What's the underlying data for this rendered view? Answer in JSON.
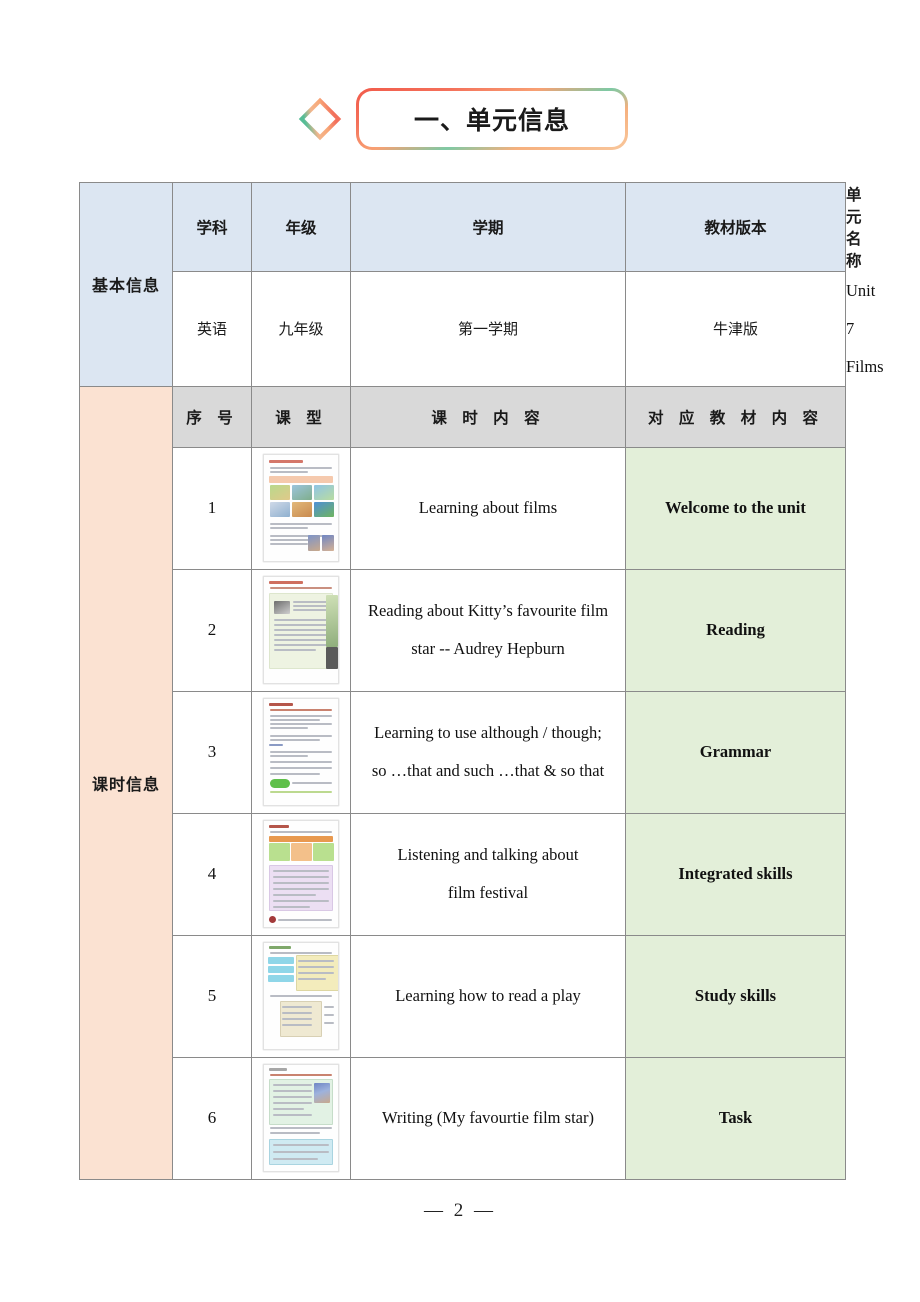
{
  "header": {
    "title": "一、单元信息",
    "diamond_icon": "diamond-outline-icon"
  },
  "basic_info": {
    "label": "基本信息",
    "columns": [
      "学科",
      "年级",
      "学期",
      "教材版本",
      "单元名称"
    ],
    "values": [
      "英语",
      "九年级",
      "第一学期",
      "牛津版",
      "Unit 7 Films"
    ]
  },
  "lesson_info": {
    "label": "课时信息",
    "columns": [
      "序  号",
      "课  型",
      "课  时  内  容",
      "对 应 教 材 内 容"
    ],
    "rows": [
      {
        "no": "1",
        "thumb": "textbook-page-thumbnail-1",
        "content": "Learning about films",
        "content_line2": "",
        "book": "Welcome to the unit"
      },
      {
        "no": "2",
        "thumb": "textbook-page-thumbnail-2",
        "content": "Reading about Kitty’s favourite film",
        "content_line2": "star -- Audrey Hepburn",
        "book": "Reading"
      },
      {
        "no": "3",
        "thumb": "textbook-page-thumbnail-3",
        "content": "Learning to use although / though;",
        "content_line2": "so …that and such …that & so that",
        "book": "Grammar"
      },
      {
        "no": "4",
        "thumb": "textbook-page-thumbnail-4",
        "content": "Listening and talking about",
        "content_line2": "film festival",
        "book": "Integrated skills"
      },
      {
        "no": "5",
        "thumb": "textbook-page-thumbnail-5",
        "content": "Learning how to read a play",
        "content_line2": "",
        "book": "Study skills"
      },
      {
        "no": "6",
        "thumb": "textbook-page-thumbnail-6",
        "content": "Writing (My favourtie film star)",
        "content_line2": "",
        "book": "Task"
      }
    ]
  },
  "footer": {
    "page_number": "— 2 —"
  },
  "colors": {
    "basic_header_bg": "#dce6f2",
    "lesson_header_bg": "#d9d9d9",
    "lesson_label_bg": "#fbe2d2",
    "book_cell_bg": "#e3efd9",
    "border": "#8a8a8a",
    "title_border_start": "#f15a4a",
    "title_border_accent": "#7fc9a4",
    "title_border_end": "#f9c79c"
  }
}
